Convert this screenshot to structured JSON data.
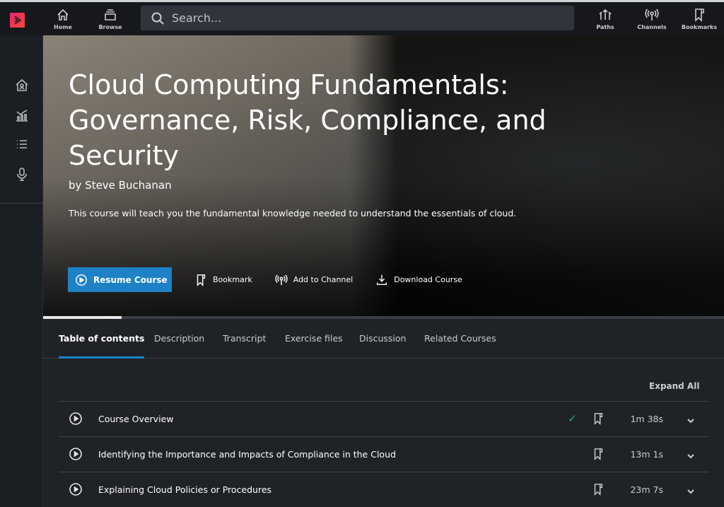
{
  "topbar": {
    "nav_left": [
      {
        "label": "Home",
        "icon": "home-icon"
      },
      {
        "label": "Browse",
        "icon": "browse-icon"
      }
    ],
    "search_placeholder": "Search...",
    "nav_right": [
      {
        "label": "Paths",
        "icon": "paths-icon"
      },
      {
        "label": "Channels",
        "icon": "channels-icon"
      },
      {
        "label": "Bookmarks",
        "icon": "bookmark-icon"
      }
    ]
  },
  "sidebar": {
    "icons": [
      "dashboard-home-icon",
      "analytics-icon",
      "list-icon",
      "microphone-icon"
    ]
  },
  "hero": {
    "title": "Cloud Computing Fundamentals: Governance, Risk, Compliance, and Security",
    "author": "by Steve Buchanan",
    "description": "This course will teach you the fundamental knowledge needed to understand the essentials of cloud.",
    "actions": {
      "resume": "Resume Course",
      "bookmark": "Bookmark",
      "add_channel": "Add to Channel",
      "download": "Download Course"
    },
    "progress_fraction": 0.115
  },
  "tabs": [
    "Table of contents",
    "Description",
    "Transcript",
    "Exercise files",
    "Discussion",
    "Related Courses"
  ],
  "toc": {
    "expand_all": "Expand All",
    "modules": [
      {
        "title": "Course Overview",
        "duration": "1m 38s",
        "completed": true
      },
      {
        "title": "Identifying the Importance and Impacts of Compliance in the Cloud",
        "duration": "13m 1s",
        "completed": false
      },
      {
        "title": "Explaining Cloud Policies or Procedures",
        "duration": "23m 7s",
        "completed": false
      }
    ]
  },
  "colors": {
    "accent": "#1e81c6",
    "complete": "#2aa86a",
    "brand": "#e8266c"
  }
}
